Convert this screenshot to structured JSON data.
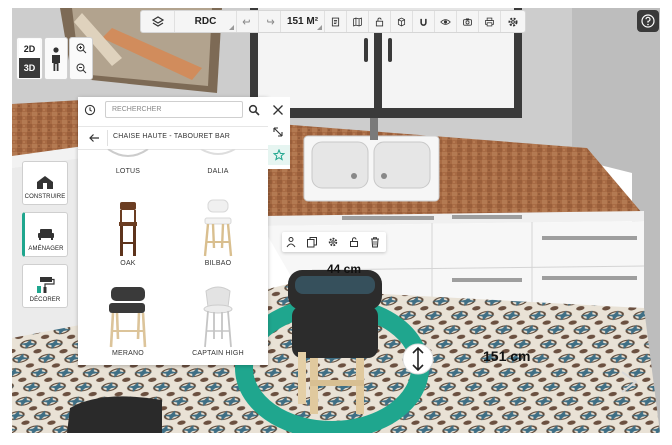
{
  "toolbar": {
    "level": "RDC",
    "area": "151 M²"
  },
  "view": {
    "mode_2d": "2D",
    "mode_3d": "3D"
  },
  "sidebar": {
    "construire": "CONSTRUIRE",
    "amenager": "AMÉNAGER",
    "decorer": "DÉCORER"
  },
  "catalog": {
    "search_placeholder": "RECHERCHER",
    "category": "CHAISE HAUTE - TABOURET BAR",
    "items": [
      "LOTUS",
      "DALIA",
      "OAK",
      "BILBAO",
      "MERANO",
      "CAPTAIN HIGH"
    ]
  },
  "scene": {
    "depth_label": "44 cm",
    "height_label": "151 cm"
  },
  "colors": {
    "accent": "#1fa68e",
    "dark_ui": "#333333",
    "wall": "#c9c9c9",
    "worktop": "#a86b44"
  }
}
